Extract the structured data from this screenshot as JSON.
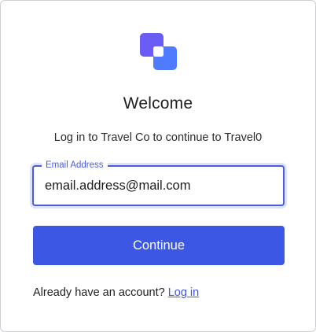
{
  "header": {
    "title": "Welcome",
    "subtitle": "Log in to Travel Co to continue to Travel0"
  },
  "form": {
    "email_label": "Email Address",
    "email_value": "email.address@mail.com"
  },
  "actions": {
    "continue_label": "Continue"
  },
  "footer": {
    "prompt": "Already have an account?",
    "login_link": "Log in"
  },
  "colors": {
    "accent": "#3c57e3",
    "logo_back": "#6a5cf4",
    "logo_front": "#4f7cff",
    "focus_ring": "#dde2fb"
  },
  "icons": {
    "logo": "overlapping-squares-logo-icon"
  }
}
